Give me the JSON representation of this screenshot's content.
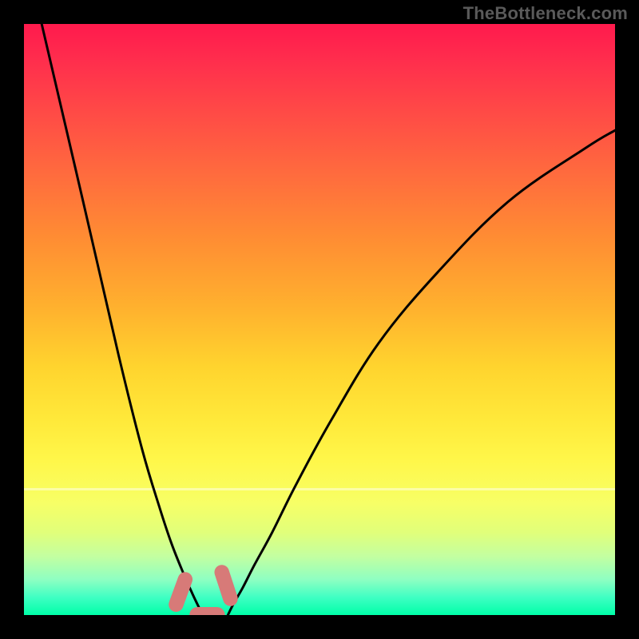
{
  "watermark": "TheBottleneck.com",
  "chart_data": {
    "type": "line",
    "title": "",
    "xlabel": "",
    "ylabel": "",
    "xlim": [
      0,
      100
    ],
    "ylim": [
      0,
      100
    ],
    "grid": false,
    "background": "gradient(red→orange→yellow→green, top→bottom)",
    "series": [
      {
        "name": "left-curve",
        "x": [
          3,
          10,
          16,
          20,
          23,
          25,
          27,
          28.5,
          29.5,
          30.2
        ],
        "y": [
          100,
          70,
          44,
          28,
          18,
          12,
          7,
          3.6,
          1.5,
          0
        ]
      },
      {
        "name": "right-curve",
        "x": [
          34.5,
          35.5,
          37,
          39,
          42,
          46,
          52,
          60,
          70,
          82,
          95,
          100
        ],
        "y": [
          0,
          2,
          4.6,
          8.5,
          14,
          22,
          33,
          46,
          58,
          70,
          79,
          82
        ]
      }
    ],
    "markers": [
      {
        "name": "left-tail-marker-1",
        "shape": "rounded-capsule",
        "x": 26.5,
        "y": 3.9,
        "w": 2.5,
        "h": 7.0,
        "angle_deg": 20
      },
      {
        "name": "right-tail-marker-1",
        "shape": "rounded-capsule",
        "x": 34.2,
        "y": 5.0,
        "w": 2.5,
        "h": 7.2,
        "angle_deg": -18
      },
      {
        "name": "valley-marker",
        "shape": "rounded-capsule",
        "x": 31.0,
        "y": 0.0,
        "w": 6.0,
        "h": 2.7,
        "angle_deg": 0
      }
    ],
    "colors": {
      "curve": "#000000",
      "markers": "#d77a78"
    }
  }
}
